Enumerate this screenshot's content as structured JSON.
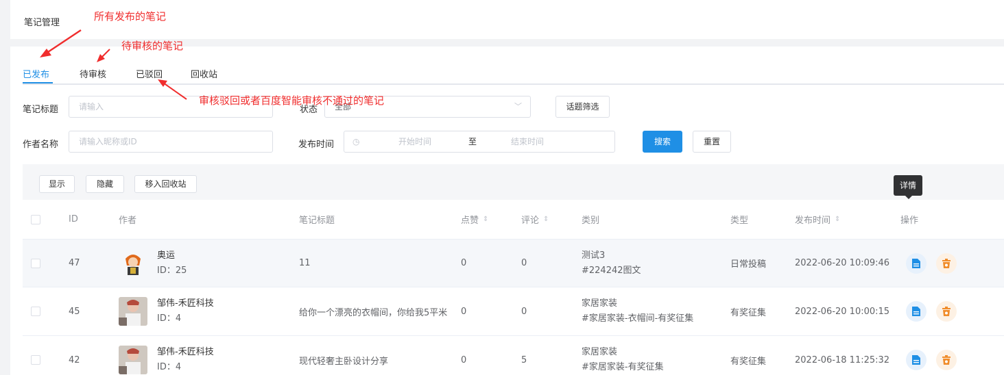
{
  "header": {
    "title": "笔记管理"
  },
  "tabs": [
    {
      "label": "已发布",
      "active": true
    },
    {
      "label": "待审核",
      "active": false
    },
    {
      "label": "已驳回",
      "active": false
    },
    {
      "label": "回收站",
      "active": false
    }
  ],
  "filters": {
    "title_label": "笔记标题",
    "title_placeholder": "请输入",
    "status_label": "状态",
    "status_value": "全部",
    "topic_button": "话题筛选",
    "author_label": "作者名称",
    "author_placeholder": "请输入昵称或ID",
    "time_label": "发布时间",
    "start_placeholder": "开始时间",
    "range_sep": "至",
    "end_placeholder": "结束时间",
    "search_button": "搜索",
    "reset_button": "重置"
  },
  "toolbar": {
    "show": "显示",
    "hide": "隐藏",
    "move_recycle": "移入回收站"
  },
  "table": {
    "columns": [
      "ID",
      "作者",
      "笔记标题",
      "点赞",
      "评论",
      "类别",
      "类型",
      "发布时间",
      "操作"
    ],
    "rows": [
      {
        "id": "47",
        "author": "奥运",
        "author_id": "ID：25",
        "title": "11",
        "likes": "0",
        "comments": "0",
        "category": "测试3",
        "tags": "#224242图文",
        "type": "日常投稿",
        "time": "2022-06-20 10:09:46"
      },
      {
        "id": "45",
        "author": "邹伟-禾匠科技",
        "author_id": "ID：4",
        "title": "给你一个漂亮的衣帽间，你给我5平米",
        "likes": "0",
        "comments": "0",
        "category": "家居家装",
        "tags": "#家居家装-衣帽间-有奖征集",
        "type": "有奖征集",
        "time": "2022-06-20 10:00:15"
      },
      {
        "id": "42",
        "author": "邹伟-禾匠科技",
        "author_id": "ID：4",
        "title": "现代轻奢主卧设计分享",
        "likes": "0",
        "comments": "5",
        "category": "家居家装",
        "tags": "#家居家装-有奖征集",
        "type": "有奖征集",
        "time": "2022-06-18 11:25:32"
      }
    ],
    "tooltip": "详情"
  },
  "annotations": {
    "published": "所有发布的笔记",
    "pending": "待审核的笔记",
    "rejected": "审核驳回或者百度智能审核不通过的笔记"
  },
  "colors": {
    "primary": "#1f8fe5",
    "annotation": "#f02d2d"
  }
}
